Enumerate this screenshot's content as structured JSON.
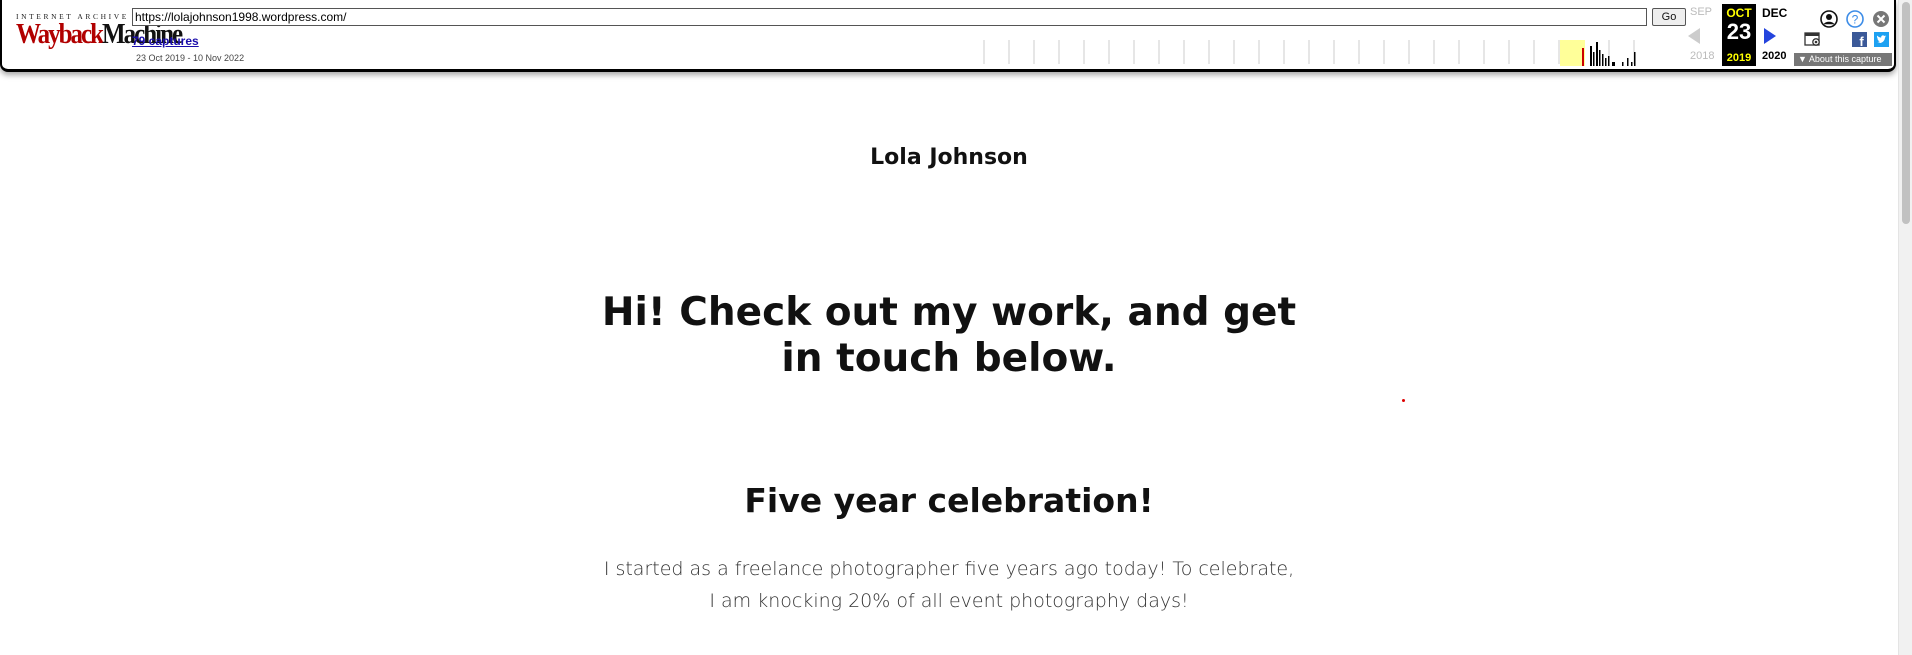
{
  "wayback": {
    "logo_top": "INTERNET ARCHIVE",
    "logo_word1": "Wayback",
    "logo_word2": "Machine",
    "url": "https://lolajohnson1998.wordpress.com/",
    "go_label": "Go",
    "captures_label": "79 captures",
    "date_range": "23 Oct 2019 - 10 Nov 2022",
    "prev_month": "SEP",
    "prev_year": "2018",
    "current_month": "OCT",
    "current_day": "23",
    "current_year": "2019",
    "next_month": "DEC",
    "next_year": "2020",
    "about_label": "About this capture",
    "icons": [
      "user-icon",
      "help-icon",
      "close-icon",
      "screenshot-icon",
      "facebook-icon",
      "twitter-icon"
    ],
    "colors": {
      "logo_red": "#b10000",
      "highlight_year": "#ffff99",
      "current_bg": "#000000",
      "current_text": "#ffff00",
      "next_arrow": "#2444dd"
    }
  },
  "page": {
    "site_title": "Lola Johnson",
    "hero_heading": "Hi! Check out my work, and get in touch below.",
    "celebration_heading": "Five year celebration!",
    "celebration_text": "I started as a freelance photographer five years ago today! To celebrate, I am knocking 20% of all event photography days!"
  }
}
